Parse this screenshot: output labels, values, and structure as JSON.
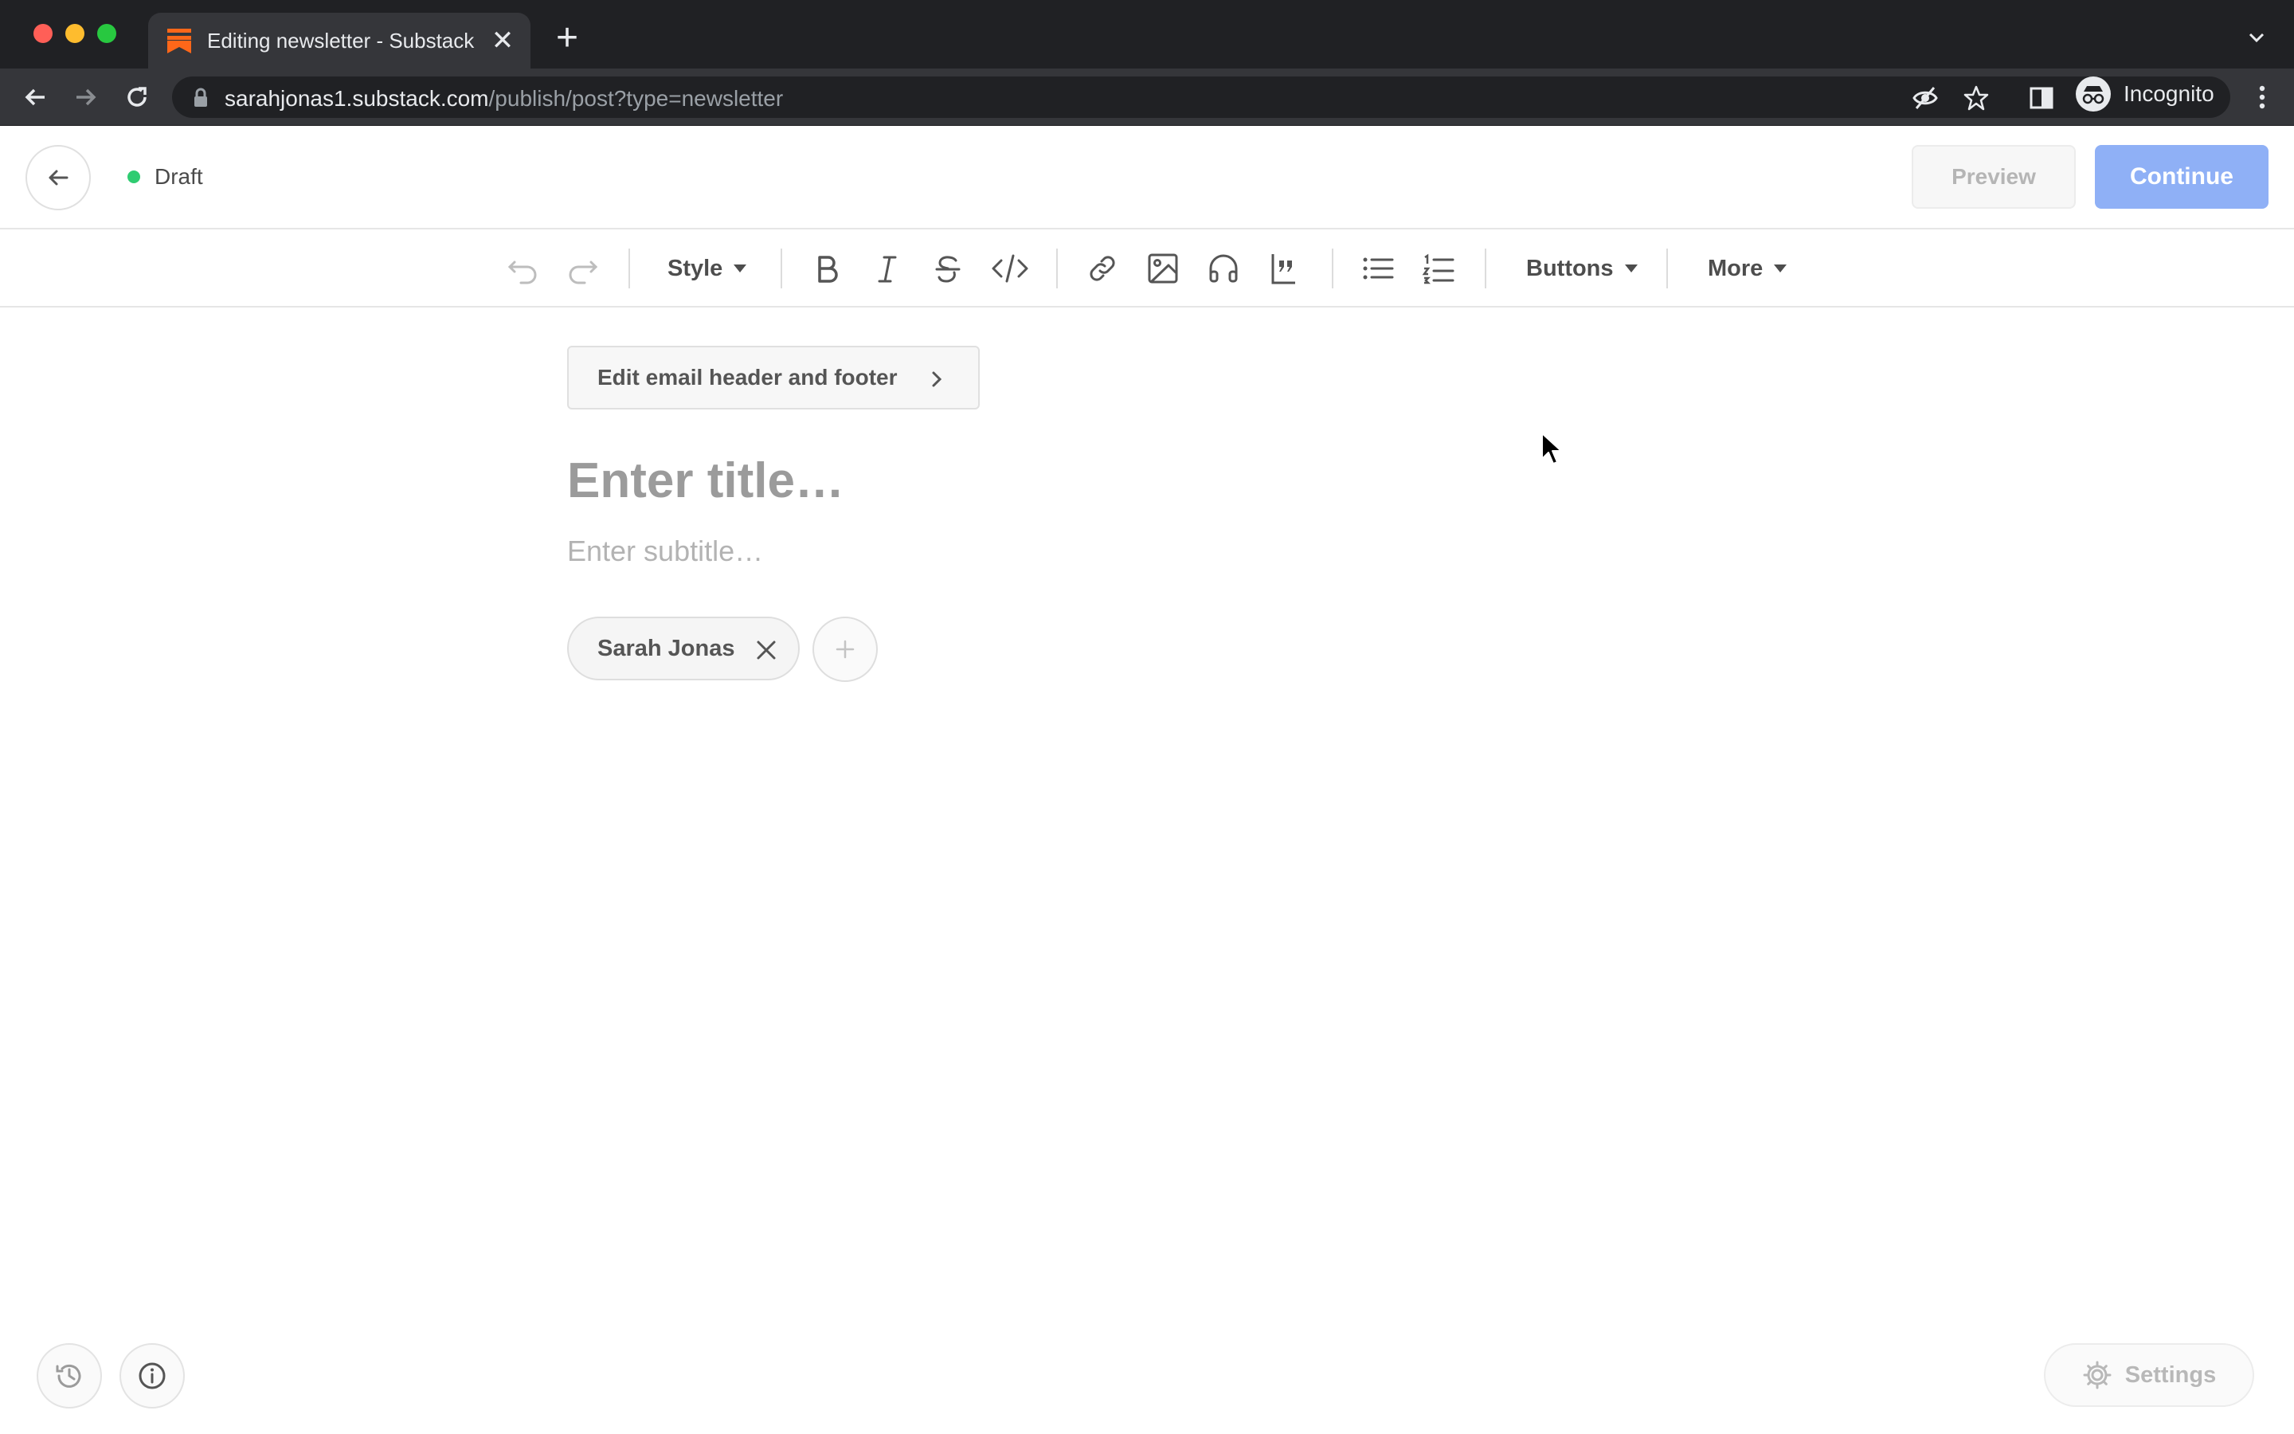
{
  "browser": {
    "tab_title": "Editing newsletter - Substack",
    "tab_close": "✕",
    "new_tab": "+",
    "url_host": "sarahjonas1.substack.com",
    "url_path": "/publish/post?type=newsletter",
    "profile_label": "Incognito",
    "accent_color": "#ff6719"
  },
  "header": {
    "status_label": "Draft",
    "status_color": "#2fcc71",
    "preview_label": "Preview",
    "continue_label": "Continue"
  },
  "toolbar": {
    "style_label": "Style",
    "buttons_label": "Buttons",
    "more_label": "More",
    "icons": [
      "undo-icon",
      "redo-icon",
      "bold-icon",
      "italic-icon",
      "strikethrough-icon",
      "code-icon",
      "link-icon",
      "image-icon",
      "audio-icon",
      "quote-icon",
      "bullet-list-icon",
      "numbered-list-icon"
    ]
  },
  "editor": {
    "edit_header_label": "Edit email header and footer",
    "title_placeholder": "Enter title…",
    "subtitle_placeholder": "Enter subtitle…",
    "author_name": "Sarah Jonas"
  },
  "footer": {
    "settings_label": "Settings"
  }
}
